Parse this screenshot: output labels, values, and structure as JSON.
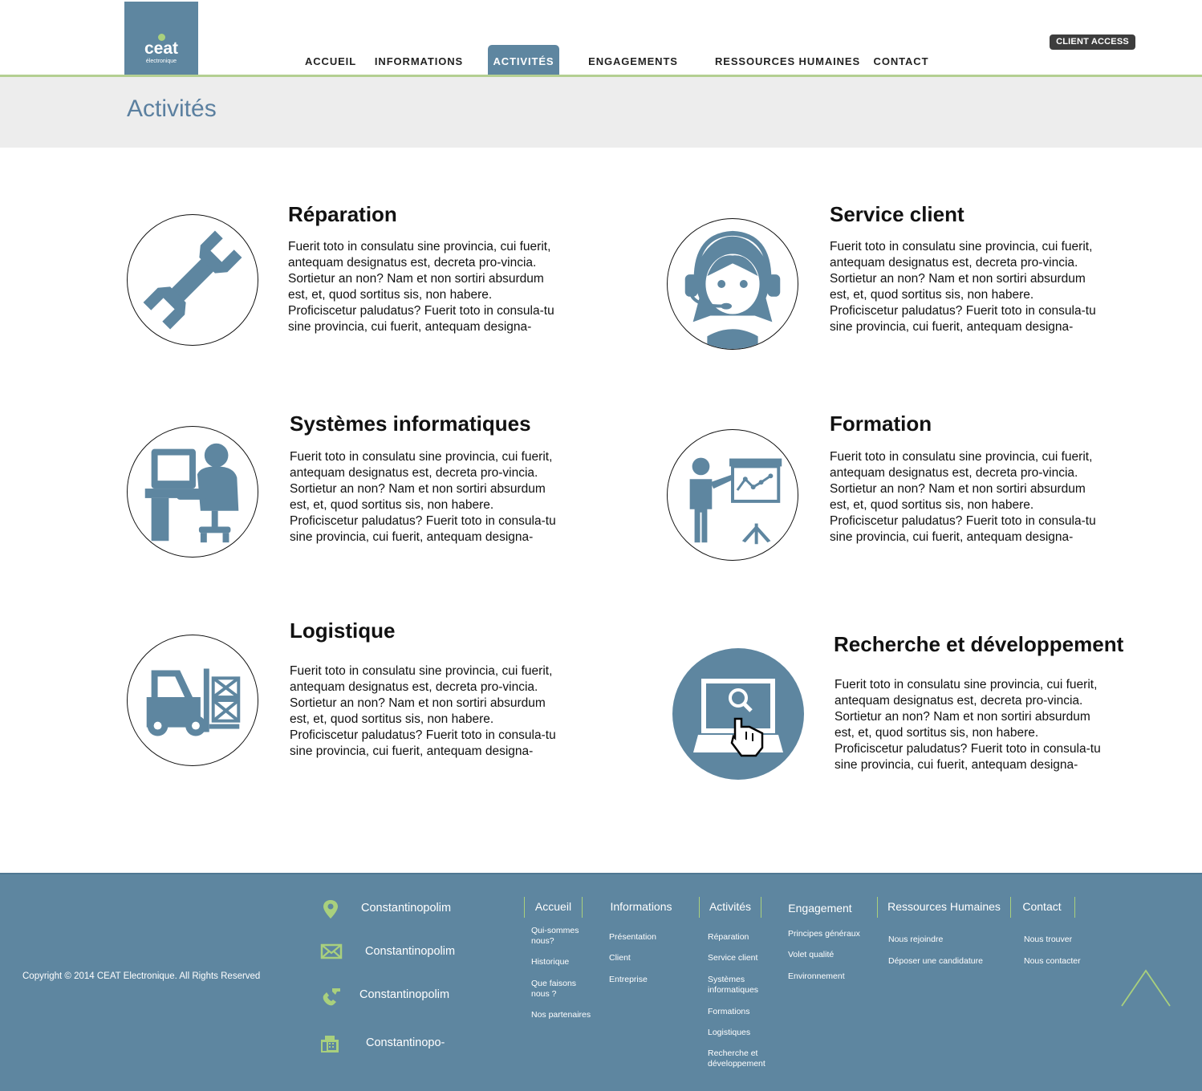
{
  "header": {
    "logo": {
      "brand": "ceat",
      "sub": "électronique"
    },
    "nav": [
      "ACCUEIL",
      "INFORMATIONS",
      "ACTIVITÉS",
      "ENGAGEMENTS",
      "RESSOURCES HUMAINES",
      "CONTACT"
    ],
    "active_nav": "ACTIVITÉS",
    "client_access": "CLIENT ACCESS"
  },
  "page": {
    "title": "Activités"
  },
  "activities": [
    {
      "title": "Réparation",
      "icon": "wrench-icon",
      "text": "Fuerit toto in consulatu sine provincia, cui fuerit, antequam designatus est, decreta pro-vincia. Sortietur an  non? Nam et non sortiri absurdum est, et, quod sortitus sis, non habere. Proficiscetur paludatus? Fuerit toto in consula-tu sine provincia, cui fuerit, antequam designa-"
    },
    {
      "title": "Service client",
      "icon": "headset-agent-icon",
      "text": "Fuerit toto in consulatu sine provincia, cui fuerit, antequam designatus est, decreta pro-vincia. Sortietur an  non? Nam et non sortiri absurdum est, et, quod sortitus sis, non habere. Proficiscetur paludatus? Fuerit toto in consula-tu sine provincia, cui fuerit, antequam designa-"
    },
    {
      "title": "Systèmes informatiques",
      "icon": "computer-user-icon",
      "text": "Fuerit toto in consulatu sine provincia, cui fuerit, antequam designatus est, decreta pro-vincia. Sortietur an  non? Nam et non sortiri absurdum est, et, quod sortitus sis, non habere. Proficiscetur paludatus? Fuerit toto in consula-tu sine provincia, cui fuerit, antequam designa-"
    },
    {
      "title": "Formation",
      "icon": "presentation-icon",
      "text": "Fuerit toto in consulatu sine provincia, cui fuerit, antequam designatus est, decreta pro-vincia. Sortietur an  non? Nam et non sortiri absurdum est, et, quod sortitus sis, non habere. Proficiscetur paludatus? Fuerit toto in consula-tu sine provincia, cui fuerit, antequam designa-"
    },
    {
      "title": "Logistique",
      "icon": "forklift-icon",
      "text": "Fuerit toto in consulatu sine provincia, cui fuerit, antequam designatus est, decreta pro-vincia. Sortietur an  non? Nam et non sortiri absurdum est, et, quod sortitus sis, non habere. Proficiscetur paludatus? Fuerit toto in consula-tu sine provincia, cui fuerit, antequam designa-"
    },
    {
      "title": "Recherche et développement",
      "icon": "laptop-search-icon",
      "text": "Fuerit toto in consulatu sine provincia, cui fuerit, antequam designatus est, decreta pro-vincia. Sortietur an  non? Nam et non sortiri absurdum est, et, quod sortitus sis, non habere. Proficiscetur paludatus? Fuerit toto in consula-tu sine provincia, cui fuerit, antequam designa-"
    }
  ],
  "footer": {
    "copyright": "Copyright © 2014 CEAT Electronique. All Rights Reserved",
    "contacts": [
      {
        "icon": "map-pin-icon",
        "text": "Constantinopolim"
      },
      {
        "icon": "envelope-icon",
        "text": "Constantinopolim"
      },
      {
        "icon": "phone-icon",
        "text": "Constantinopolim"
      },
      {
        "icon": "fax-icon",
        "text": "Constantinopo-"
      }
    ],
    "columns": [
      {
        "heading": "Accueil",
        "links": [
          "Qui-sommes nous?",
          "Historique",
          "Que faisons nous ?",
          "Nos partenaires"
        ]
      },
      {
        "heading": "Informations",
        "links": [
          "Présentation",
          "Client",
          "Entreprise"
        ]
      },
      {
        "heading": "Activités",
        "links": [
          "Réparation",
          "Service client",
          "Systèmes informatiques",
          "Formations",
          "Logistiques",
          "Recherche et développement"
        ]
      },
      {
        "heading": "Engagement",
        "links": [
          "Principes généraux",
          "Volet qualité",
          "Environnement"
        ]
      },
      {
        "heading": "Ressources Humaines",
        "links": [
          "Nous rejoindre",
          "Déposer une candidature"
        ]
      },
      {
        "heading": "Contact",
        "links": [
          "Nous trouver",
          "Nous contacter"
        ]
      }
    ],
    "back_to_top_icon": "chevron-up-icon"
  },
  "colors": {
    "brand_blue": "#5e86a0",
    "accent_green": "#a9d07d",
    "title_blue": "#5b80a0",
    "band_gray": "#ededed"
  }
}
